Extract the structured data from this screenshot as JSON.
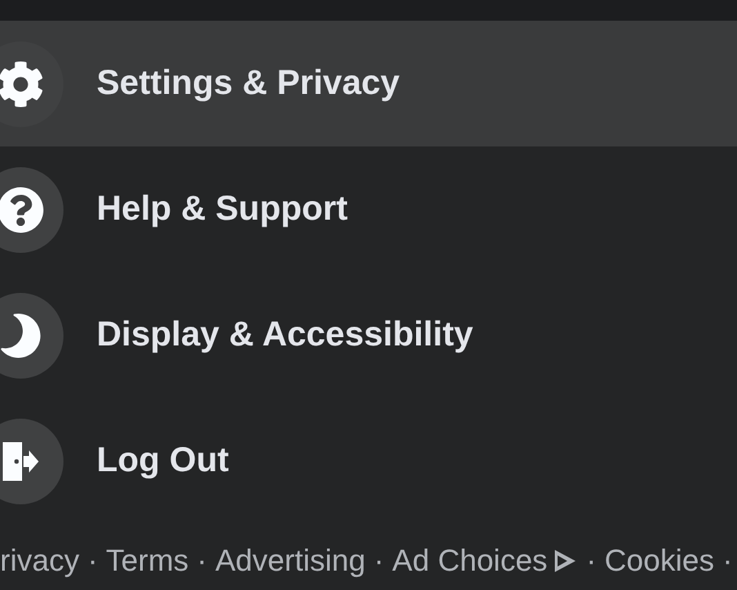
{
  "menu": {
    "items": [
      {
        "kind": "settings",
        "label": "Settings & Privacy",
        "selected": true
      },
      {
        "kind": "help",
        "label": "Help & Support",
        "selected": false
      },
      {
        "kind": "display",
        "label": "Display & Accessibility",
        "selected": false
      },
      {
        "kind": "logout",
        "label": "Log Out",
        "selected": false
      }
    ]
  },
  "footer": {
    "separator": "·",
    "links": [
      {
        "label": "rivacy"
      },
      {
        "label": "Terms"
      },
      {
        "label": "Advertising"
      },
      {
        "label": "Ad Choices",
        "adchoices_icon": true
      },
      {
        "label": "Cookies"
      }
    ]
  }
}
